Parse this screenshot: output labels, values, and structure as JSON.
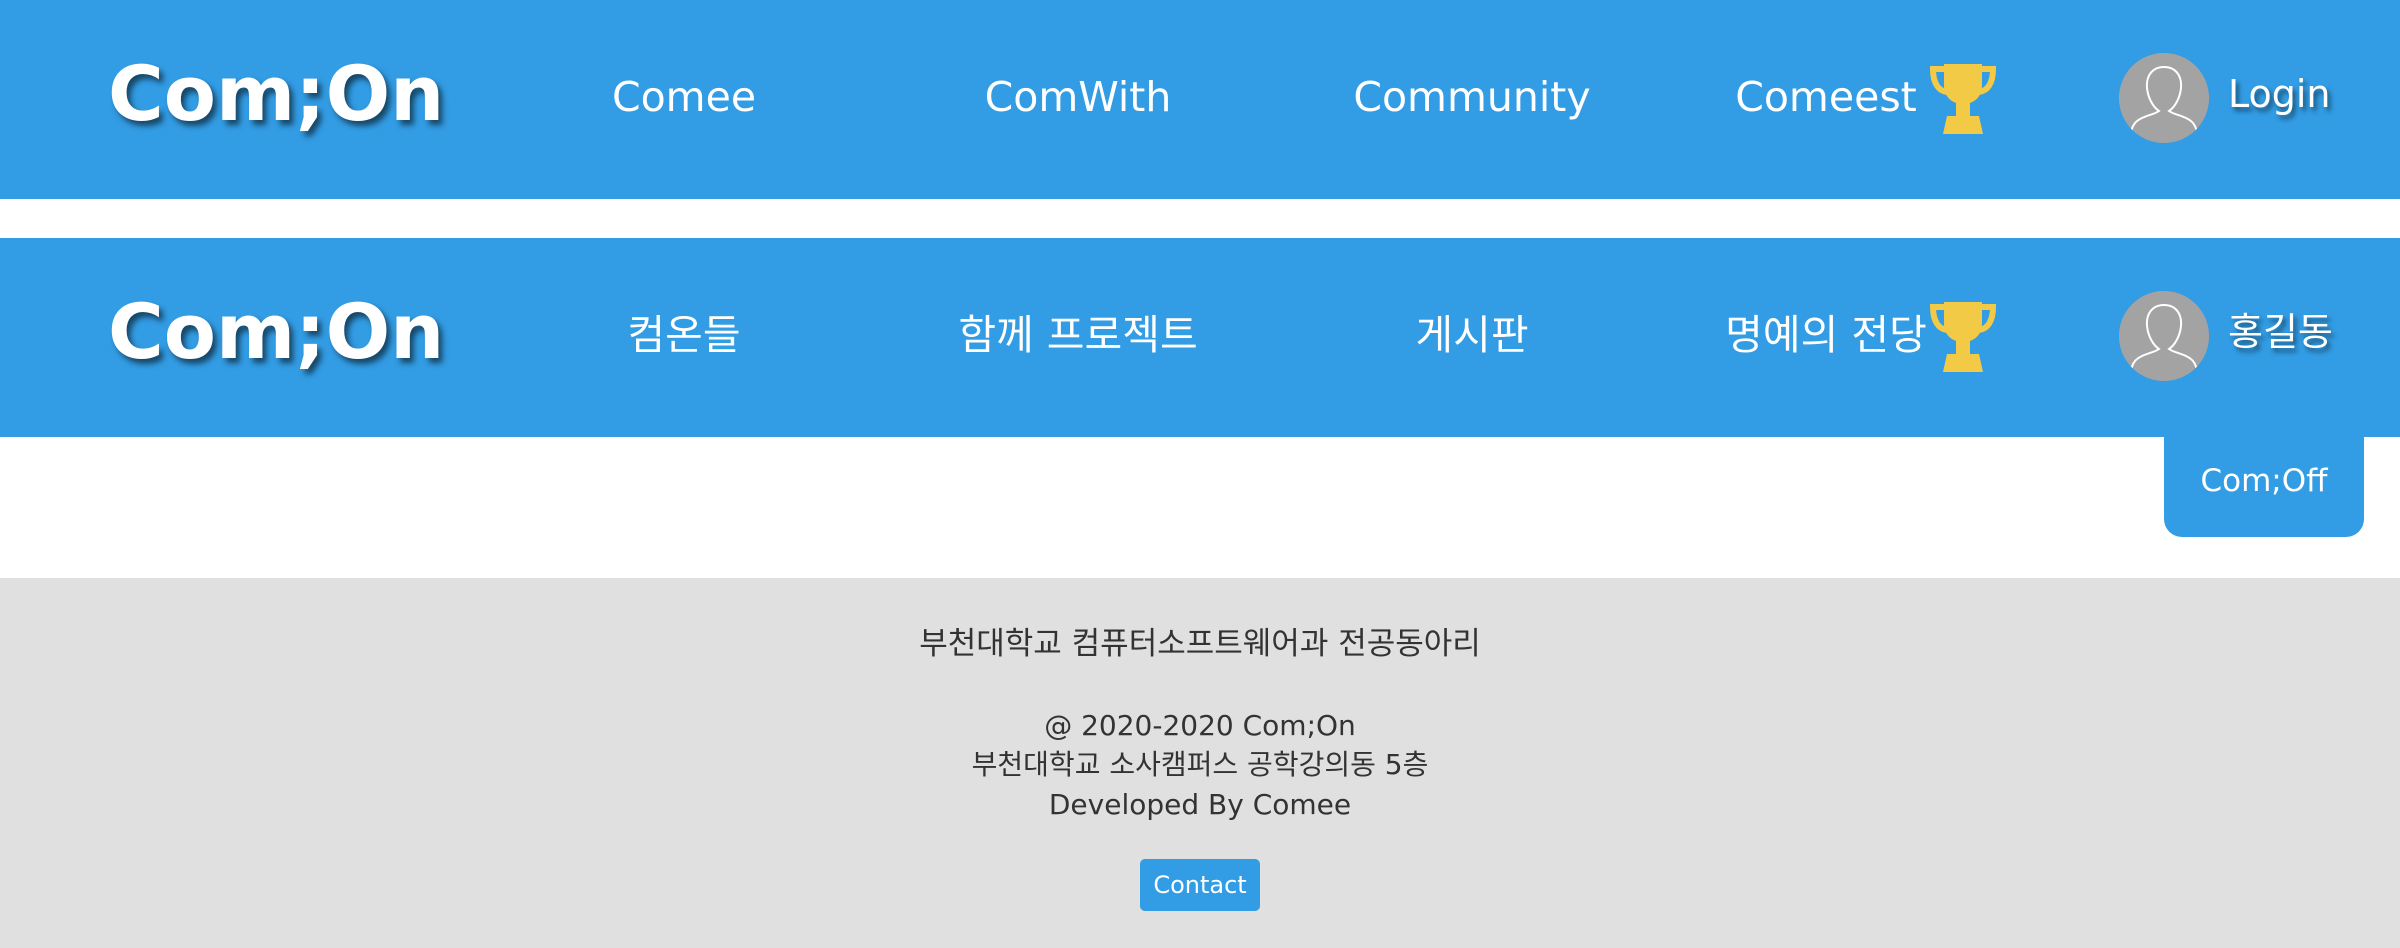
{
  "navbar_en": {
    "logo": "Com;On",
    "items": [
      {
        "label": "Comee"
      },
      {
        "label": "ComWith"
      },
      {
        "label": "Community"
      },
      {
        "label": "Comeest"
      }
    ],
    "trophy_icon": "trophy-icon",
    "avatar_icon": "user-avatar-icon",
    "user_link": "Login"
  },
  "navbar_ko": {
    "logo": "Com;On",
    "items": [
      {
        "label": "컴온들"
      },
      {
        "label": "함께 프로젝트"
      },
      {
        "label": "게시판"
      },
      {
        "label": "명예의 전당"
      }
    ],
    "trophy_icon": "trophy-icon",
    "avatar_icon": "user-avatar-icon",
    "user_link": "홍길동"
  },
  "dropdown": {
    "label": "Com;Off"
  },
  "footer": {
    "title": "부천대학교 컴퓨터소프트웨어과 전공동아리",
    "copyright": "@ 2020-2020 Com;On",
    "address": "부천대학교 소사캠퍼스 공학강의동 5층",
    "developer": "Developed By Comee",
    "contact_label": "Contact"
  },
  "colors": {
    "primary": "#329ce4",
    "trophy": "#f2ca46",
    "avatar": "#a3a3a3",
    "footer_bg": "#e0e0e0",
    "footer_text": "#333333"
  }
}
